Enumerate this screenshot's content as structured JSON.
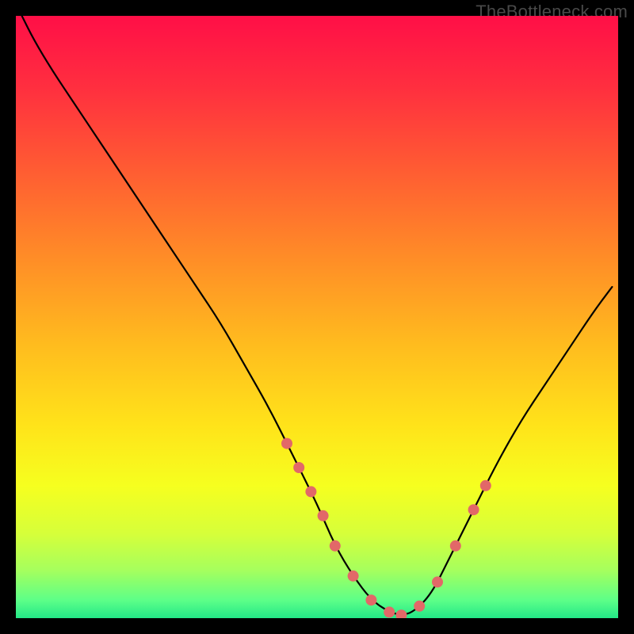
{
  "watermark": "TheBottleneck.com",
  "chart_data": {
    "type": "line",
    "title": "",
    "xlabel": "",
    "ylabel": "",
    "xlim": [
      0,
      100
    ],
    "ylim": [
      0,
      100
    ],
    "grid": false,
    "legend": false,
    "curve": {
      "name": "bottleneck-curve",
      "x": [
        1,
        3,
        6,
        10,
        14,
        18,
        22,
        26,
        30,
        34,
        38,
        42,
        46,
        50,
        53,
        56,
        59,
        62,
        64,
        66,
        69,
        72,
        76,
        80,
        84,
        88,
        92,
        96,
        99
      ],
      "y": [
        100,
        96,
        91,
        85,
        79,
        73,
        67,
        61,
        55,
        49,
        42,
        35,
        27,
        19,
        12,
        7,
        3,
        1,
        0.5,
        1,
        4,
        10,
        18,
        26,
        33,
        39,
        45,
        51,
        55
      ]
    },
    "markers": {
      "name": "highlight-dots",
      "color": "#e26868",
      "radius": 7,
      "x": [
        45,
        47,
        49,
        51,
        53,
        56,
        59,
        62,
        64,
        67,
        70,
        73,
        76,
        78
      ],
      "y": [
        29,
        25,
        21,
        17,
        12,
        7,
        3,
        1,
        0.5,
        2,
        6,
        12,
        18,
        22
      ]
    },
    "gradient_stops": [
      {
        "offset": 0.0,
        "color": "#ff0f47"
      },
      {
        "offset": 0.12,
        "color": "#ff2f3f"
      },
      {
        "offset": 0.25,
        "color": "#ff5a33"
      },
      {
        "offset": 0.4,
        "color": "#ff8c27"
      },
      {
        "offset": 0.55,
        "color": "#ffbd1e"
      },
      {
        "offset": 0.68,
        "color": "#ffe31a"
      },
      {
        "offset": 0.78,
        "color": "#f6ff1f"
      },
      {
        "offset": 0.86,
        "color": "#d6ff3a"
      },
      {
        "offset": 0.92,
        "color": "#a6ff5d"
      },
      {
        "offset": 0.97,
        "color": "#5dff88"
      },
      {
        "offset": 1.0,
        "color": "#23e887"
      }
    ]
  }
}
